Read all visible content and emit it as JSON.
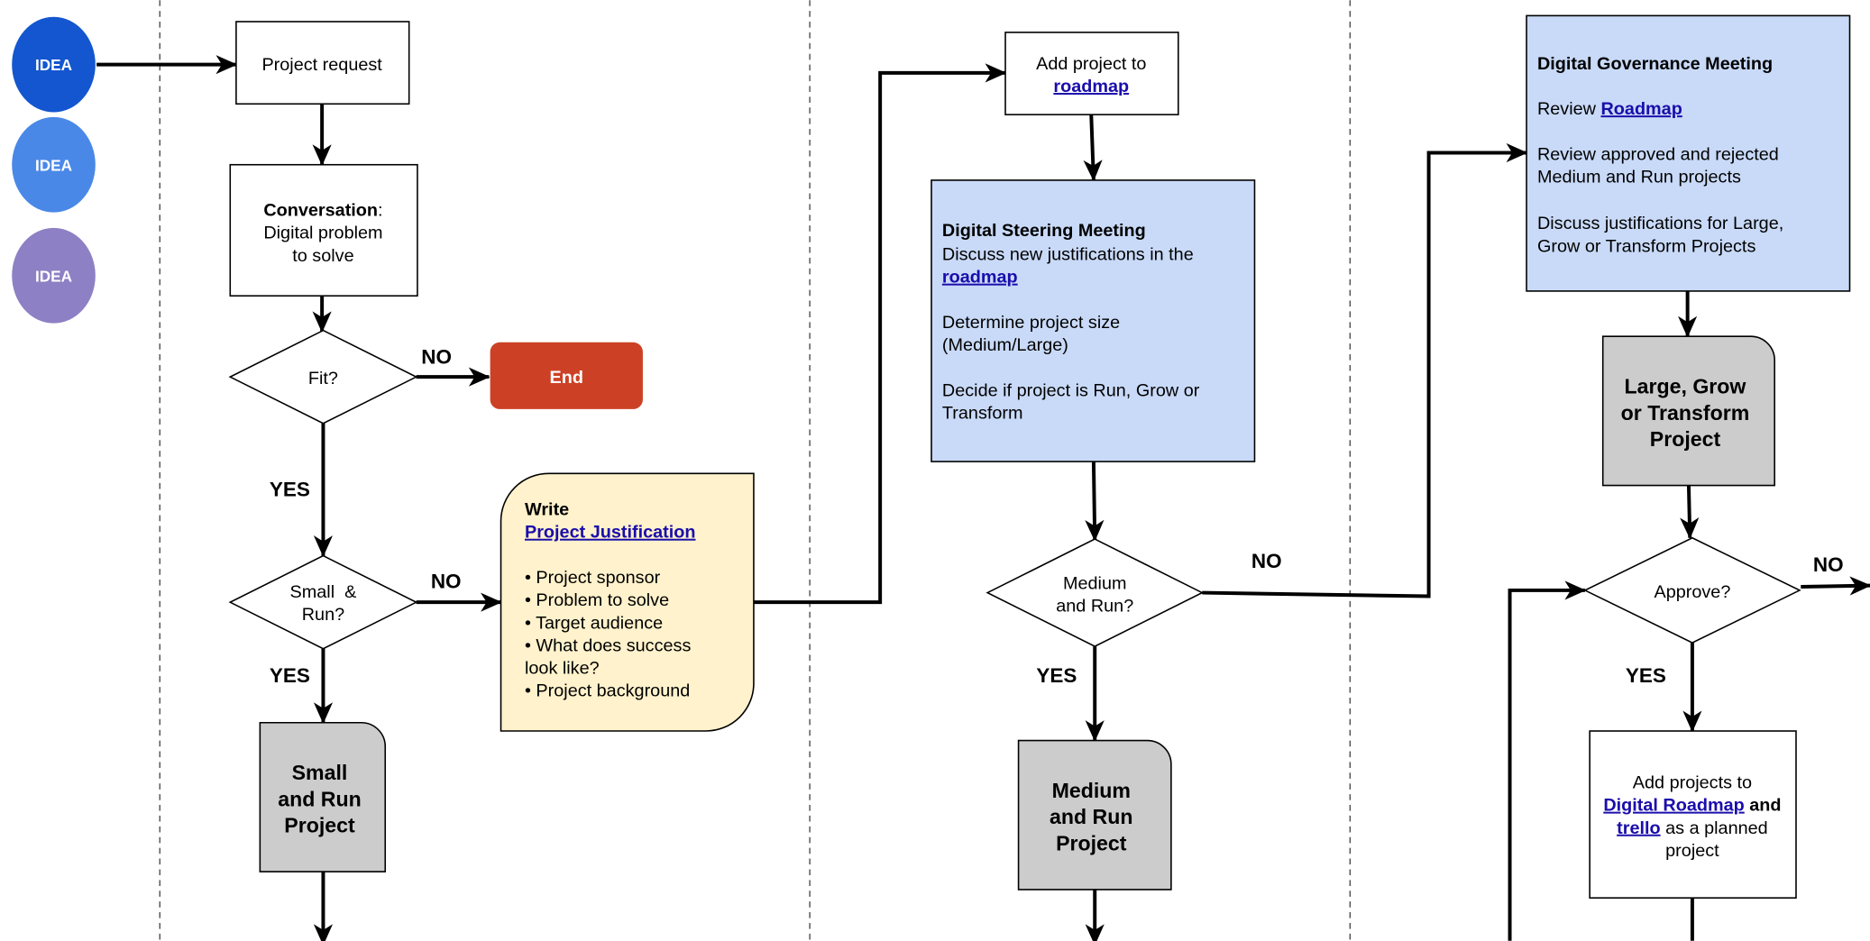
{
  "colors": {
    "idea_1": "#1356cf",
    "idea_2": "#4a88e8",
    "idea_3": "#8e80c4",
    "end": "#cc4125",
    "note": "#fff2cc",
    "meeting": "#c9daf8",
    "project": "#cccccc",
    "link": "#1a0dab"
  },
  "ideas": [
    "IDEA",
    "IDEA",
    "IDEA"
  ],
  "nodes": {
    "project_request": "Project request",
    "conversation": {
      "bold": "Conversation",
      "rest": ":",
      "line2": "Digital problem",
      "line3": "to solve"
    },
    "fit": "Fit?",
    "end": "End",
    "small_run_q": {
      "line1": "Small  &",
      "line2": "Run?"
    },
    "write": {
      "title": "Write",
      "link": "Project Justification",
      "bullets": [
        "• Project sponsor",
        "• Problem to solve",
        "• Target audience",
        "• What does success",
        "look like?",
        "• Project background"
      ]
    },
    "small_run_project": [
      "Small",
      "and Run",
      "Project"
    ],
    "add_to_roadmap": {
      "line1": "Add project to",
      "link": "roadmap"
    },
    "steering": {
      "title": "Digital Steering Meeting",
      "line1": "Discuss new justifications in the",
      "link": "roadmap",
      "line2": "Determine project size",
      "line3": "(Medium/Large)",
      "line4": "Decide if project is Run, Grow or",
      "line5": "Transform"
    },
    "medium_run_q": {
      "line1": "Medium",
      "line2": "and Run?"
    },
    "medium_run_project": [
      "Medium",
      "and Run",
      "Project"
    ],
    "governance": {
      "title": "Digital Governance Meeting",
      "review": "Review ",
      "review_link": "Roadmap",
      "line1": "Review approved and rejected",
      "line2": "Medium and Run projects",
      "line3": "Discuss justifications for Large,",
      "line4": "Grow or Transform Projects"
    },
    "large_project": [
      "Large, Grow",
      "or Transform",
      "Project"
    ],
    "approve": "Approve?",
    "add_projects": {
      "line1": "Add projects to",
      "link1": "Digital Roadmap",
      "and": " and",
      "link2": "trello",
      "rest": " as a planned",
      "line4": "project"
    }
  },
  "edge_labels": {
    "no": "NO",
    "yes": "YES"
  }
}
